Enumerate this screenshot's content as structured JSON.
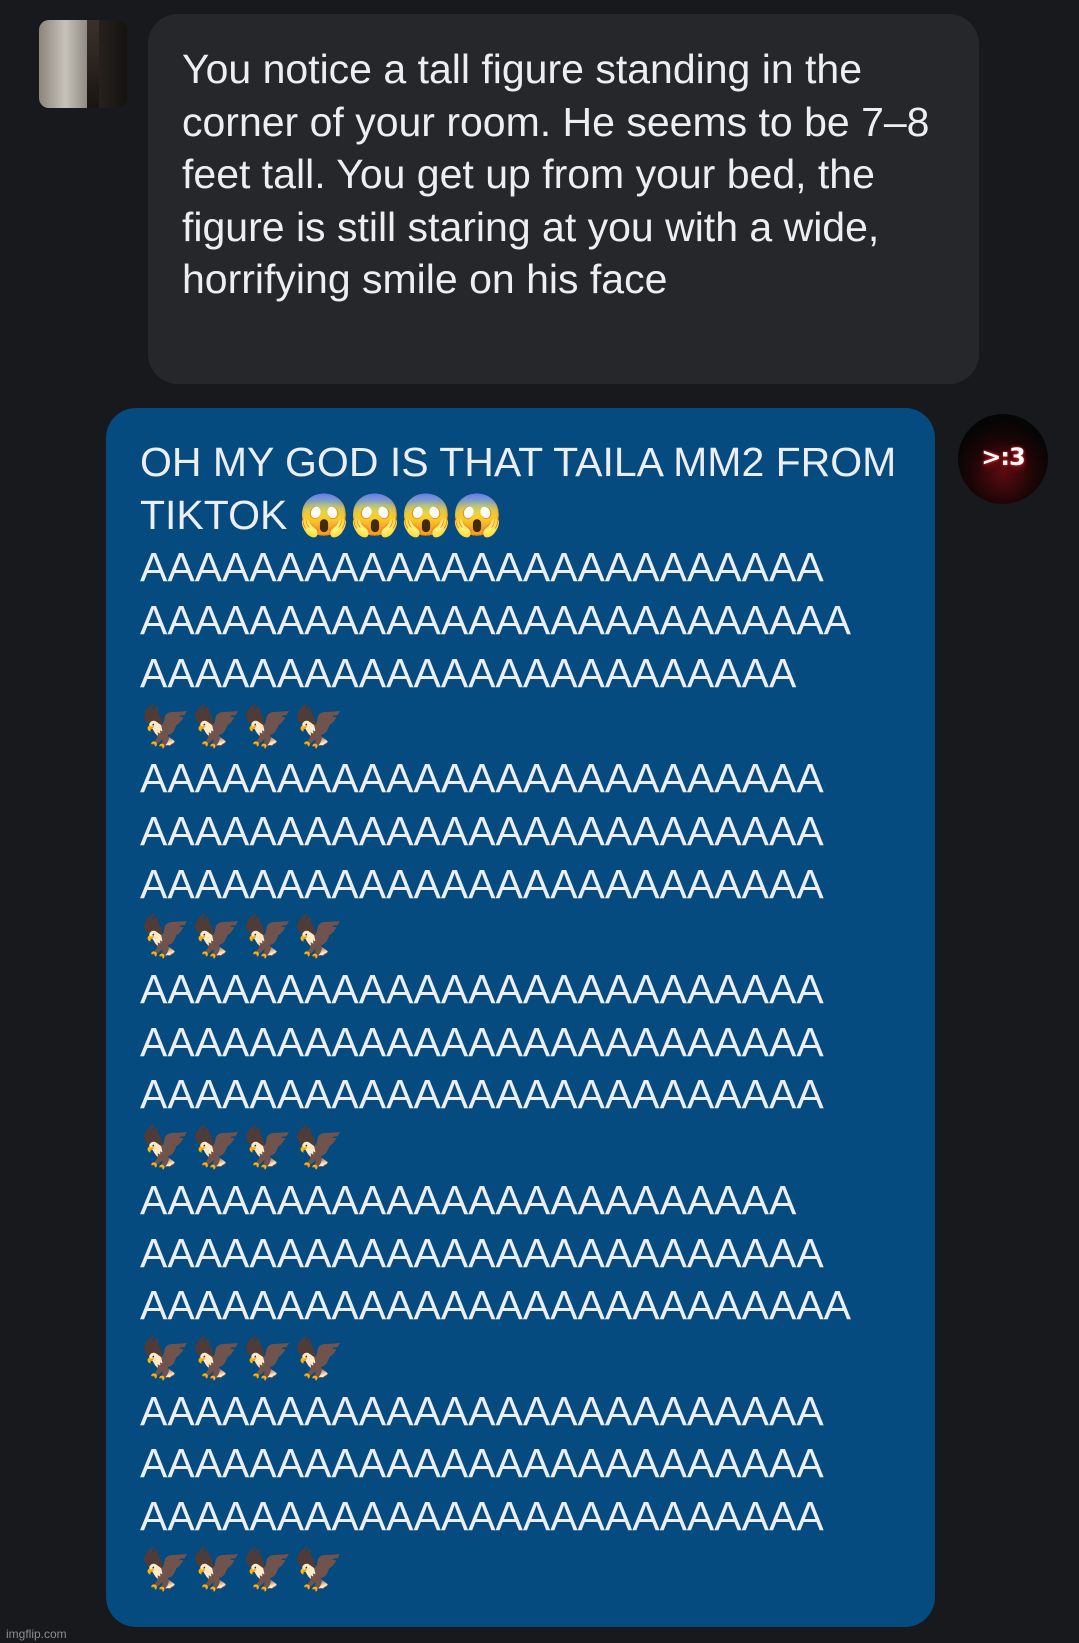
{
  "received_message": {
    "text": "You notice a tall figure standing in the corner of your room. He seems to be 7–8 feet tall. You get up from your bed, the figure is still staring at you with a wide, horrifying smile on his face"
  },
  "sent_message": {
    "text": "OH MY GOD IS THAT TAILA MM2 FROM TIKTOK 😱😱😱😱\nAAAAAAAAAAAAAAAAAAAAAAAAA\nAAAAAAAAAAAAAAAAAAAAAAAAAA\nAAAAAAAAAAAAAAAAAAAAAAAA\n🦅🦅🦅🦅\nAAAAAAAAAAAAAAAAAAAAAAAAA\nAAAAAAAAAAAAAAAAAAAAAAAAA\nAAAAAAAAAAAAAAAAAAAAAAAAA\n🦅🦅🦅🦅\nAAAAAAAAAAAAAAAAAAAAAAAAA\nAAAAAAAAAAAAAAAAAAAAAAAAA\nAAAAAAAAAAAAAAAAAAAAAAAAA\n🦅🦅🦅🦅\nAAAAAAAAAAAAAAAAAAAAAAAA\nAAAAAAAAAAAAAAAAAAAAAAAAA\nAAAAAAAAAAAAAAAAAAAAAAAAAA\n🦅🦅🦅🦅\nAAAAAAAAAAAAAAAAAAAAAAAAA\nAAAAAAAAAAAAAAAAAAAAAAAAA\nAAAAAAAAAAAAAAAAAAAAAAAAA\n🦅🦅🦅🦅"
  },
  "sender_avatar": {
    "label": ">:3"
  },
  "watermark": "imgflip.com",
  "colors": {
    "background": "#18191c",
    "received_bubble": "#26272b",
    "sent_bubble": "#054b80",
    "text": "#eceef1"
  }
}
